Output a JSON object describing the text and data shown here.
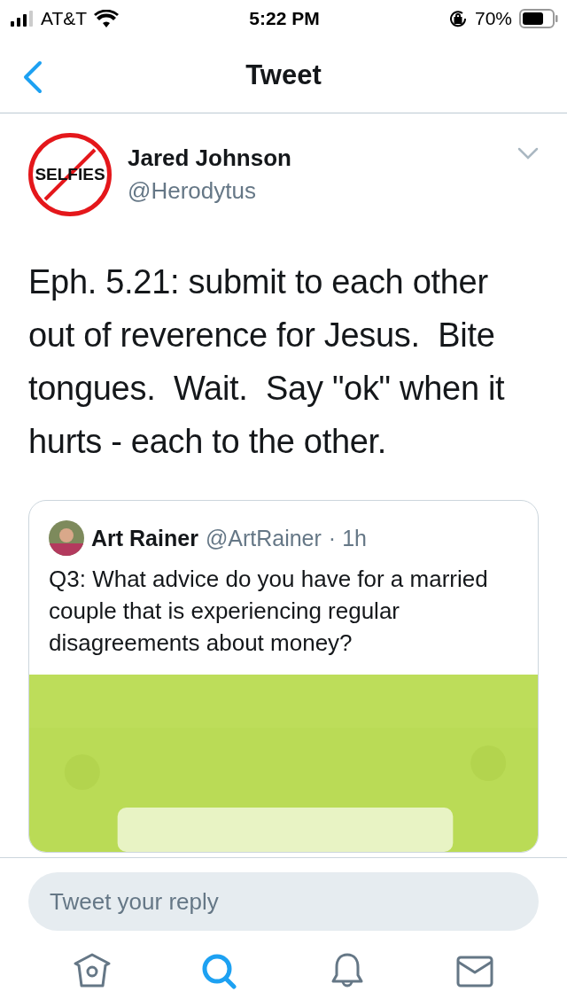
{
  "status_bar": {
    "carrier": "AT&T",
    "time": "5:22 PM",
    "battery": "70%"
  },
  "nav": {
    "title": "Tweet"
  },
  "tweet": {
    "avatar_label": "SELFIES",
    "name": "Jared Johnson",
    "handle": "@Herodytus",
    "text": "Eph. 5.21: submit to each other out of reverence for Jesus.  Bite tongues.  Wait.  Say \"ok\" when it hurts - each to the other.",
    "quoted": {
      "name": "Art Rainer",
      "handle": "@ArtRainer",
      "time": "· 1h",
      "text": "Q3: What advice do you have for a married couple that is experiencing regular disagreements about money?"
    }
  },
  "reply": {
    "placeholder": "Tweet your reply"
  },
  "tabs": [
    {
      "kind": "home",
      "selected": false
    },
    {
      "kind": "search",
      "selected": true
    },
    {
      "kind": "notifications",
      "selected": false
    },
    {
      "kind": "messages",
      "selected": false
    }
  ]
}
